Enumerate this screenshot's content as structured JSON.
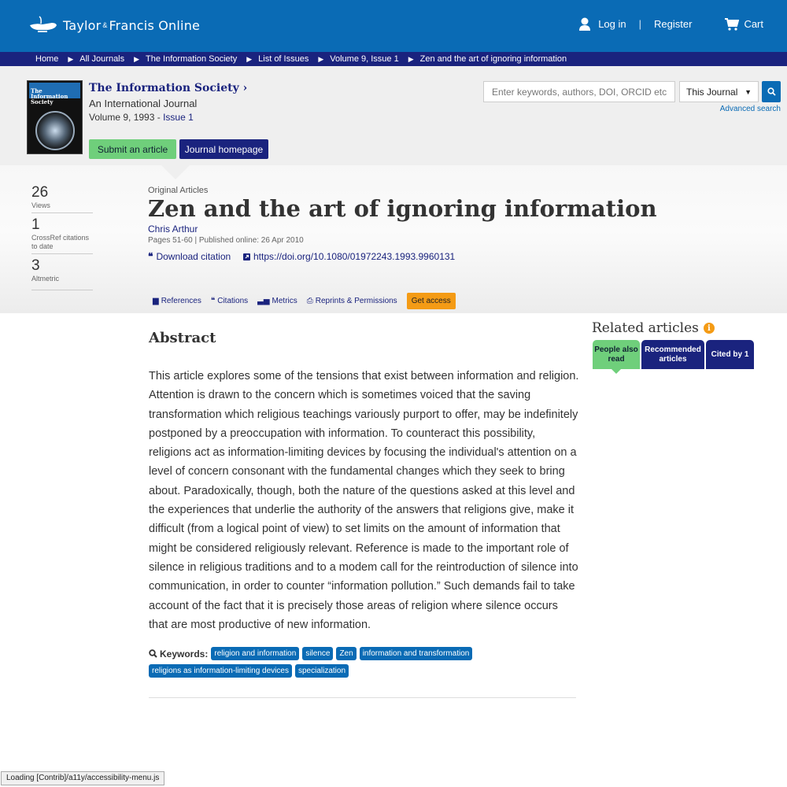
{
  "header": {
    "logo_text_1": "Taylor",
    "logo_amp": "&",
    "logo_text_2": "Francis Online",
    "login": "Log in",
    "register": "Register",
    "cart": "Cart"
  },
  "breadcrumb": [
    "Home",
    "All Journals",
    "The Information Society",
    "List of Issues",
    "Volume 9, Issue 1",
    "Zen and the art of ignoring information"
  ],
  "journal": {
    "cover_title": "The Information Society",
    "title": "The Information Society",
    "subtitle": "An International Journal",
    "volume": "Volume 9, 1993 - ",
    "issue": "Issue 1",
    "submit": "Submit an article",
    "homepage": "Journal homepage"
  },
  "search": {
    "placeholder": "Enter keywords, authors, DOI, ORCID etc",
    "scope": "This Journal",
    "advanced": "Advanced search"
  },
  "metrics": [
    {
      "value": "26",
      "label": "Views"
    },
    {
      "value": "1",
      "label": "CrossRef citations to date"
    },
    {
      "value": "3",
      "label": "Altmetric"
    }
  ],
  "article": {
    "category": "Original Articles",
    "title": "Zen and the art of ignoring information",
    "author": "Chris Arthur",
    "pages": "Pages 51-60 | Published online: 26 Apr 2010",
    "download_citation": "Download citation",
    "doi": "https://doi.org/10.1080/01972243.1993.9960131"
  },
  "tabs": {
    "references": "References",
    "citations": "Citations",
    "metrics": "Metrics",
    "reprints": "Reprints & Permissions",
    "access": "Get access"
  },
  "abstract": {
    "heading": "Abstract",
    "text": "This article explores some of the tensions that exist between information and religion. Attention is drawn to the concern which is sometimes voiced that the saving transformation which religious teachings variously purport to offer, may be indefinitely postponed by a preoccupation with information. To counteract this possibility, religions act as information-limiting devices by focusing the individual's attention on a level of concern consonant with the fundamental changes which they seek to bring about. Paradoxically, though, both the nature of the questions asked at this level and the experiences that underlie the authority of the answers that religions give, make it difficult (from a logical point of view) to set limits on the amount of information that might be considered religiously relevant. Reference is made to the important role of silence in religious traditions and to a modem call for the reintroduction of silence into communication, in order to counter “information pollution.” Such demands fail to take account of the fact that it is precisely those areas of religion where silence occurs that are most productive of new information."
  },
  "keywords": {
    "label": "Keywords:",
    "items": [
      "religion and information",
      "silence",
      "Zen",
      "information and transformation",
      "religions as information-limiting devices",
      "specialization"
    ]
  },
  "related": {
    "heading": "Related articles",
    "tab1": "People also read",
    "tab2": "Recommended articles",
    "tab3": "Cited by 1"
  },
  "status_bar": "Loading [Contrib]/a11y/accessibility-menu.js",
  "colors": {
    "brand_blue": "#0a6bb5",
    "navy": "#1a237e",
    "green": "#6fcf7b",
    "orange": "#f49b15"
  }
}
